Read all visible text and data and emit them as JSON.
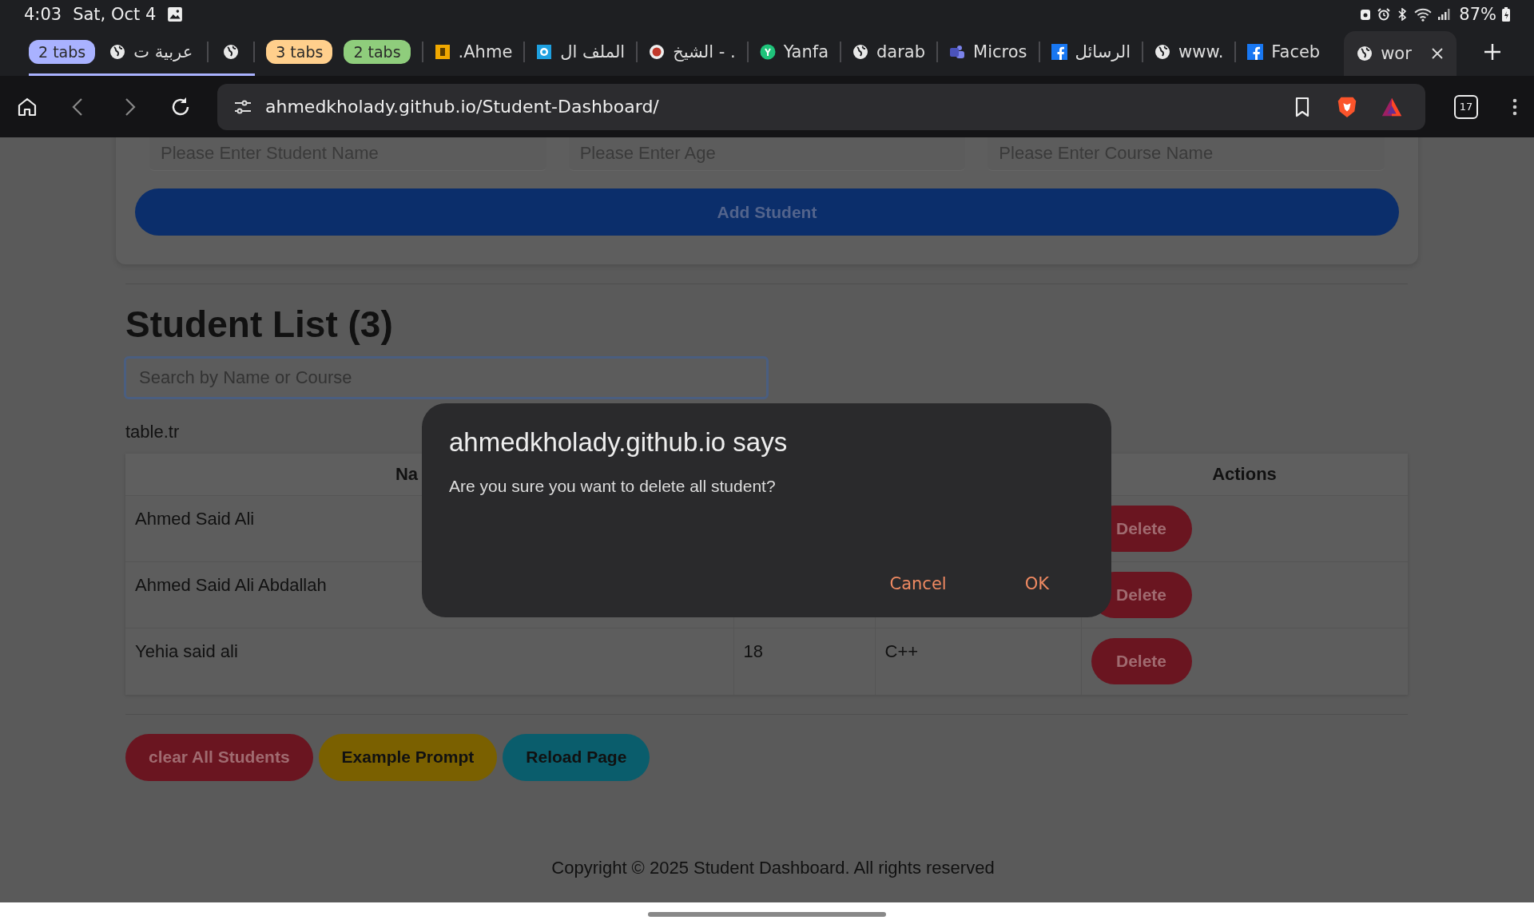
{
  "status_bar": {
    "time": "4:03",
    "date": "Sat, Oct 4",
    "battery": "87%"
  },
  "tabs": [
    {
      "kind": "group",
      "label": "2 tabs",
      "color": "#a9b2ff",
      "expanded": true,
      "children": [
        {
          "label": "عربية ت",
          "selected": false
        },
        {
          "selected": false
        }
      ]
    },
    {
      "kind": "group",
      "label": "3 tabs",
      "color": "#ffcf8c",
      "expanded": false
    },
    {
      "kind": "group",
      "label": "2 tabs",
      "color": "#8fcd7c",
      "expanded": false
    },
    {
      "kind": "page",
      "label": ".Ahme",
      "selected": false
    },
    {
      "kind": "page",
      "label": "الملف ال",
      "selected": false
    },
    {
      "kind": "page",
      "label": "الشيخ - .",
      "selected": false
    },
    {
      "kind": "page",
      "label": "Yanfa",
      "selected": false
    },
    {
      "kind": "page",
      "label": "darab",
      "selected": false
    },
    {
      "kind": "page",
      "label": "Micros",
      "selected": false
    },
    {
      "kind": "page",
      "label": "الرسائل",
      "selected": false
    },
    {
      "kind": "page",
      "label": "www.",
      "selected": false
    },
    {
      "kind": "page",
      "label": "Faceb",
      "selected": false
    },
    {
      "kind": "page",
      "label": "wor",
      "selected": true
    }
  ],
  "toolbar": {
    "url": "ahmedkholady.github.io/Student-Dashboard/",
    "tab_count": "17"
  },
  "form": {
    "placeholders": [
      "Please Enter Student Name",
      "Please Enter Age",
      "Please Enter Course Name"
    ],
    "submit": "Add Student"
  },
  "list": {
    "heading": "Student List (3)",
    "search_placeholder": "Search by Name or Course",
    "note": "table.tr"
  },
  "table": {
    "columns": [
      "Na",
      "Actions"
    ],
    "rows": [
      {
        "name": "Ahmed Said Ali",
        "action": "Delete"
      },
      {
        "name": "Ahmed Said Ali Abdallah",
        "action": "Delete"
      },
      {
        "name": "Yehia said ali",
        "age": "18",
        "course": "C++",
        "action": "Delete"
      }
    ]
  },
  "actions": [
    {
      "kind": "danger",
      "label": "clear All Students"
    },
    {
      "kind": "warning",
      "label": "Example Prompt"
    },
    {
      "kind": "info",
      "label": "Reload Page"
    }
  ],
  "footer": "Copyright © 2025 Student Dashboard. All rights reserved",
  "dialog": {
    "title": "ahmedkholady.github.io says",
    "message": "Are you sure you want to delete all student?",
    "buttons": [
      "Cancel",
      "OK"
    ]
  }
}
